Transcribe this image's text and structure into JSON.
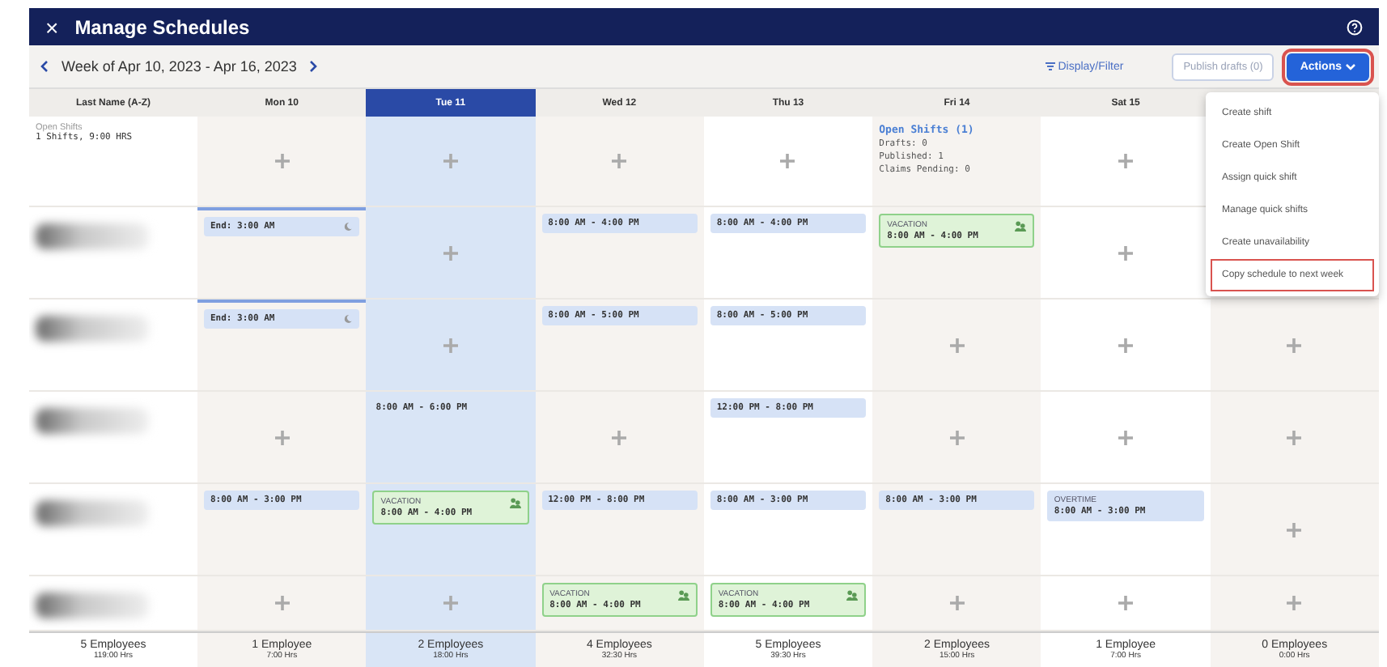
{
  "window": {
    "title": "Manage Schedules",
    "close_icon": "×"
  },
  "toolbar": {
    "week": "Week of Apr 10, 2023 - Apr 16, 2023",
    "display_filter": "Display/Filter",
    "publish": "Publish drafts (0)",
    "actions": {
      "label": "Actions",
      "outlined": true
    }
  },
  "actions_menu": {
    "items": [
      {
        "label": "Create shift",
        "outlined": false
      },
      {
        "label": "Create Open Shift",
        "outlined": false
      },
      {
        "label": "Assign quick shift",
        "outlined": false
      },
      {
        "label": "Manage quick shifts",
        "outlined": false
      },
      {
        "label": "Create unavailability",
        "outlined": false
      },
      {
        "label": "Copy schedule to next week",
        "outlined": true
      }
    ]
  },
  "grid": {
    "name_header": "Last Name (A-Z)",
    "days": [
      {
        "label": "Mon 10",
        "selected": false,
        "shaded": true
      },
      {
        "label": "Tue 11",
        "selected": true
      },
      {
        "label": "Wed 12",
        "selected": false,
        "shaded": true
      },
      {
        "label": "Thu 13",
        "selected": false,
        "shaded": false
      },
      {
        "label": "Fri 14",
        "selected": false,
        "shaded": true
      },
      {
        "label": "Sat 15",
        "selected": false,
        "shaded": false
      },
      {
        "selected": false,
        "shaded": true
      }
    ],
    "open_shifts": {
      "title": "Open Shifts",
      "summary": "1 Shifts, 9:00 HRS",
      "cells": [
        {
          "kind": "add"
        },
        {
          "kind": "add"
        },
        {
          "kind": "add"
        },
        {
          "kind": "add"
        },
        {
          "kind": "open",
          "title": "Open Shifts (1)",
          "lines": [
            "Drafts: 0",
            "Published: 1",
            "Claims Pending: 0"
          ]
        },
        {
          "kind": "add"
        },
        {
          "kind": "hidden"
        }
      ]
    },
    "rows": [
      {
        "cells": [
          {
            "kind": "shift",
            "time": "End: 3:00 AM",
            "overnight": true
          },
          {
            "kind": "add"
          },
          {
            "kind": "shift",
            "time": "8:00 AM - 4:00 PM"
          },
          {
            "kind": "shift",
            "time": "8:00 AM - 4:00 PM"
          },
          {
            "kind": "leave",
            "label": "VACATION",
            "time": "8:00 AM - 4:00 PM"
          },
          {
            "kind": "add"
          },
          {
            "kind": "hidden"
          }
        ]
      },
      {
        "cells": [
          {
            "kind": "shift",
            "time": "End: 3:00 AM",
            "overnight": true
          },
          {
            "kind": "add"
          },
          {
            "kind": "shift",
            "time": "8:00 AM - 5:00 PM"
          },
          {
            "kind": "shift",
            "time": "8:00 AM - 5:00 PM"
          },
          {
            "kind": "add"
          },
          {
            "kind": "add"
          },
          {
            "kind": "add"
          }
        ]
      },
      {
        "cells": [
          {
            "kind": "add"
          },
          {
            "kind": "shift",
            "time": "8:00 AM - 6:00 PM",
            "plain": true
          },
          {
            "kind": "add"
          },
          {
            "kind": "shift",
            "time": "12:00 PM - 8:00 PM"
          },
          {
            "kind": "add"
          },
          {
            "kind": "add"
          },
          {
            "kind": "add"
          }
        ]
      },
      {
        "cells": [
          {
            "kind": "shift",
            "time": "8:00 AM - 3:00 PM"
          },
          {
            "kind": "leave",
            "label": "VACATION",
            "time": "8:00 AM - 4:00 PM"
          },
          {
            "kind": "shift",
            "time": "12:00 PM - 8:00 PM"
          },
          {
            "kind": "shift",
            "time": "8:00 AM - 3:00 PM"
          },
          {
            "kind": "shift",
            "time": "8:00 AM - 3:00 PM"
          },
          {
            "kind": "shift",
            "label": "OVERTIME",
            "time": "8:00 AM - 3:00 PM"
          },
          {
            "kind": "add"
          }
        ]
      },
      {
        "cells": [
          {
            "kind": "add"
          },
          {
            "kind": "add"
          },
          {
            "kind": "leave",
            "label": "VACATION",
            "time": "8:00 AM - 4:00 PM"
          },
          {
            "kind": "leave",
            "label": "VACATION",
            "time": "8:00 AM - 4:00 PM"
          },
          {
            "kind": "add"
          },
          {
            "kind": "add"
          },
          {
            "kind": "add"
          }
        ]
      }
    ],
    "totals": [
      {
        "count": "5 Employees",
        "hours": "119:00 Hrs"
      },
      {
        "count": "1 Employee",
        "hours": "7:00 Hrs"
      },
      {
        "count": "2 Employees",
        "hours": "18:00 Hrs"
      },
      {
        "count": "4 Employees",
        "hours": "32:30 Hrs"
      },
      {
        "count": "5 Employees",
        "hours": "39:30 Hrs"
      },
      {
        "count": "2 Employees",
        "hours": "15:00 Hrs"
      },
      {
        "count": "1 Employee",
        "hours": "7:00 Hrs"
      },
      {
        "count": "0 Employees",
        "hours": "0:00 Hrs"
      }
    ]
  }
}
